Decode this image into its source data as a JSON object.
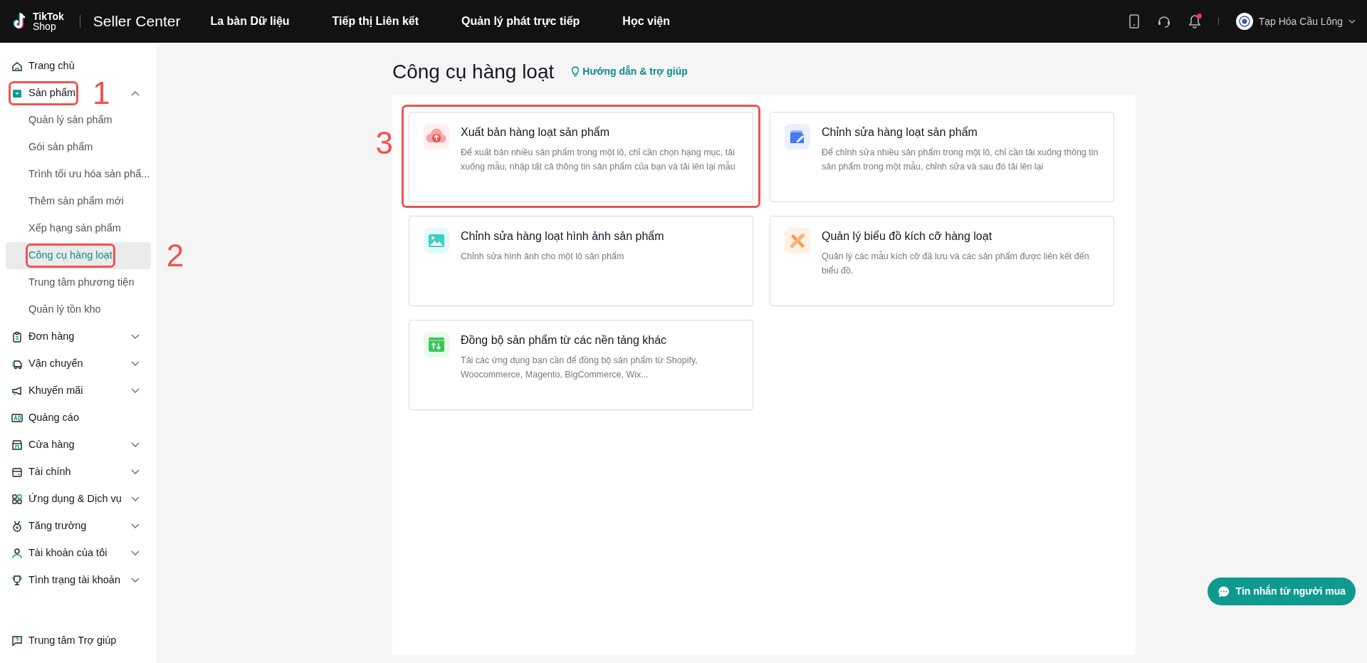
{
  "topbar": {
    "logo_line_1": "TikTok",
    "logo_line_2": "Shop",
    "product": "Seller Center",
    "nav": [
      "La bàn Dữ liệu",
      "Tiếp thị Liên kết",
      "Quản lý phát trực tiếp",
      "Học viện"
    ],
    "unread_notifications": true,
    "account_name": "Tạp Hóa Cầu Lông"
  },
  "sidebar": {
    "items": [
      {
        "kind": "link",
        "label": "Trang chủ"
      },
      {
        "kind": "group",
        "label": "Sản phẩm",
        "expanded": true,
        "callout": "1",
        "children": [
          {
            "label": "Quản lý sản phẩm",
            "selected": false
          },
          {
            "label": "Gói sản phẩm",
            "selected": false
          },
          {
            "label": "Trình tối ưu hóa sản phẩ...",
            "selected": false
          },
          {
            "label": "Thêm sản phẩm mới",
            "selected": false
          },
          {
            "label": "Xếp hạng sản phẩm",
            "selected": false
          },
          {
            "label": "Công cụ hàng loạt",
            "selected": true,
            "callout": "2"
          },
          {
            "label": "Trung tâm phương tiện",
            "selected": false
          },
          {
            "label": "Quản lý tồn kho",
            "selected": false
          }
        ]
      },
      {
        "kind": "group",
        "label": "Đơn hàng",
        "expanded": false
      },
      {
        "kind": "group",
        "label": "Vận chuyển",
        "expanded": false
      },
      {
        "kind": "group",
        "label": "Khuyến mãi",
        "expanded": false
      },
      {
        "kind": "link",
        "label": "Quảng cáo"
      },
      {
        "kind": "group",
        "label": "Cửa hàng",
        "expanded": false
      },
      {
        "kind": "group",
        "label": "Tài chính",
        "expanded": false
      },
      {
        "kind": "group",
        "label": "Ứng dụng & Dịch vụ",
        "expanded": false
      },
      {
        "kind": "group",
        "label": "Tăng trưởng",
        "expanded": false
      },
      {
        "kind": "group",
        "label": "Tài khoản của tôi",
        "expanded": false
      },
      {
        "kind": "group",
        "label": "Tình trạng tài khoản",
        "expanded": false
      }
    ],
    "footer_link": "Trung tâm Trợ giúp"
  },
  "page": {
    "title": "Công cụ hàng loạt",
    "help_link": "Hướng dẫn & trợ giúp",
    "tools": [
      {
        "title": "Xuất bản hàng loạt sản phẩm",
        "description": "Để xuất bản nhiều sản phẩm trong một lô, chỉ cần chọn hạng mục, tải xuống mẫu, nhập tất cả thông tin sản phẩm của bạn và tải lên lại mẫu",
        "callout": "3"
      },
      {
        "title": "Chỉnh sửa hàng loạt sản phẩm",
        "description": "Để chỉnh sửa nhiều sản phẩm trong một lô, chỉ cần tải xuống thông tin sản phẩm trong một mẫu, chỉnh sửa và sau đó tải lên lại"
      },
      {
        "title": "Chỉnh sửa hàng loạt hình ảnh sản phẩm",
        "description": "Chỉnh sửa hình ảnh cho một lô sản phẩm"
      },
      {
        "title": "Quản lý biểu đồ kích cỡ hàng loạt",
        "description": "Quản lý các mẫu kích cỡ đã lưu và các sản phẩm được liên kết đến biểu đồ."
      },
      {
        "title": "Đồng bộ sản phẩm từ các nền tảng khác",
        "description": "Tải các ứng dụng bạn cần để đồng bộ sản phẩm từ Shopify, Woocommerce, Magento, BigCommerce, Wix..."
      }
    ]
  },
  "chat_button": "Tin nhắn từ người mua"
}
